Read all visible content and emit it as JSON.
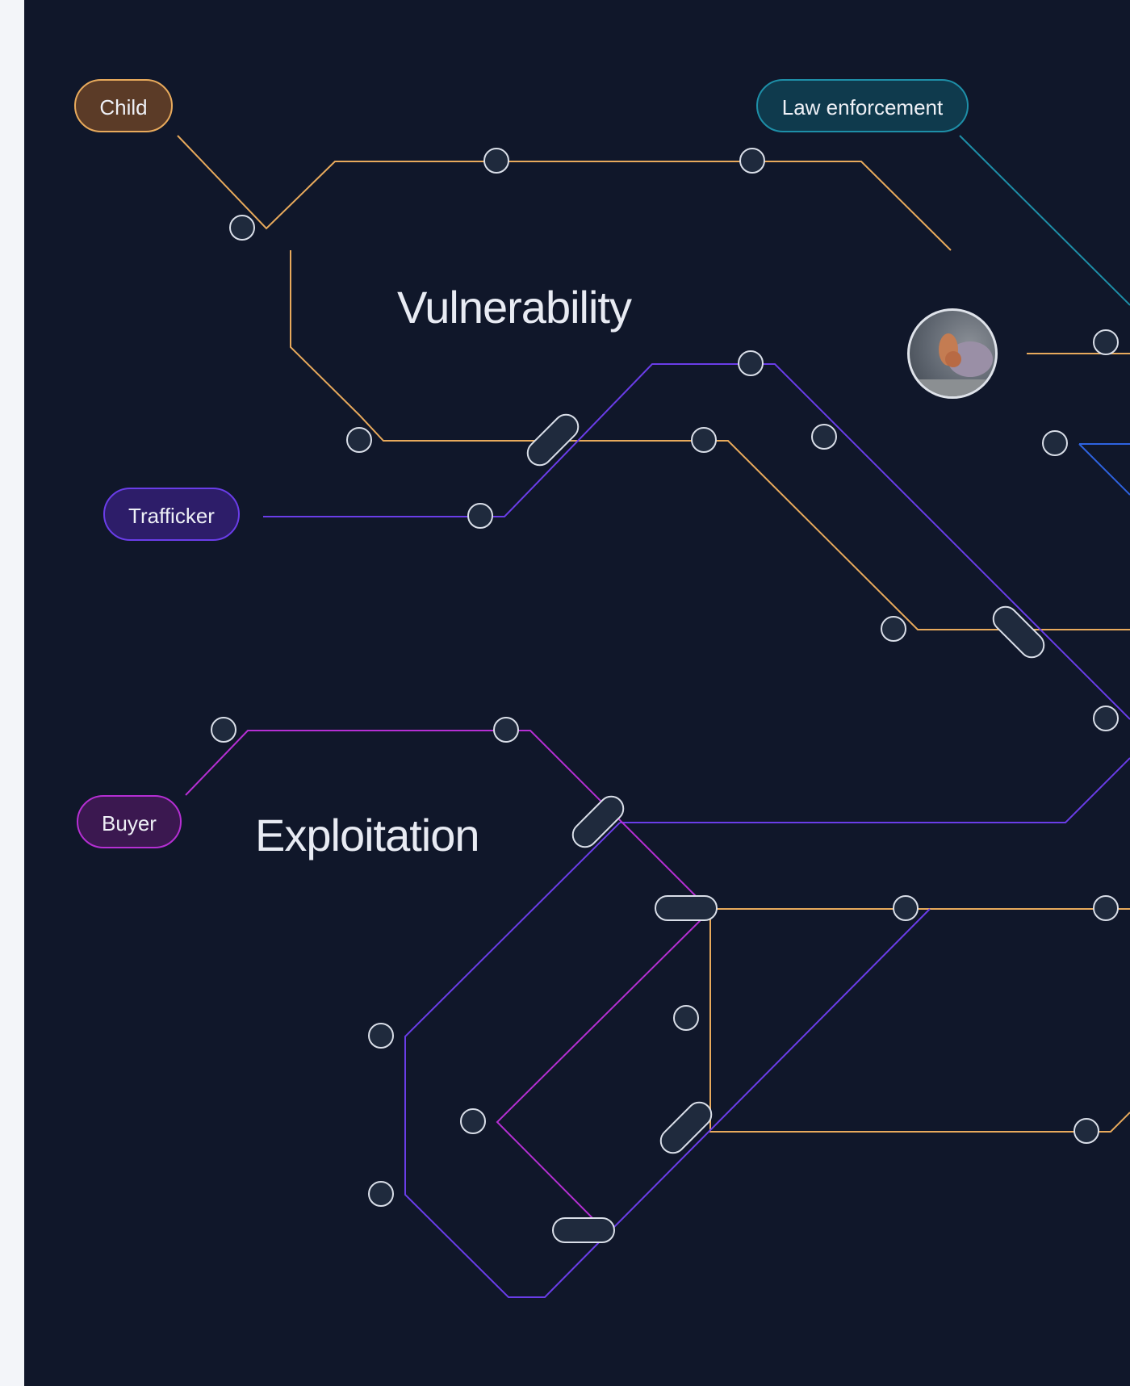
{
  "colors": {
    "child": "#e8aa5c",
    "law_enforcement": "#1e8fa8",
    "trafficker": "#6a3de8",
    "buyer": "#b52fd3",
    "blue": "#2e63e0",
    "node_fill": "#1f2a3d",
    "node_stroke": "#d9dee8",
    "background": "#10172a"
  },
  "labels": {
    "child": "Child",
    "law_enforcement": "Law enforcement",
    "trafficker": "Trafficker",
    "buyer": "Buyer"
  },
  "regions": {
    "vulnerability": "Vulnerability",
    "exploitation": "Exploitation"
  },
  "photo_icon": "hands-photo"
}
